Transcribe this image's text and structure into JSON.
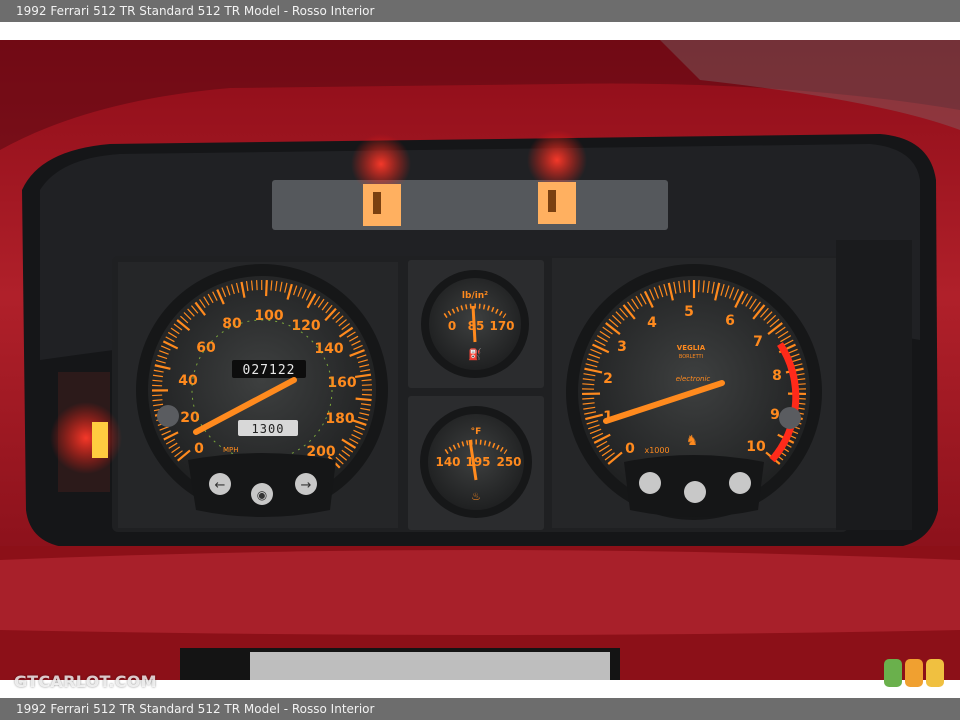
{
  "caption": "1992 Ferrari 512 TR Standard 512 TR Model - Rosso Interior",
  "watermark": "GTCARLOT.COM",
  "odometer": "027122",
  "trip": "1300",
  "speedometer": {
    "labels": [
      "0",
      "20",
      "40",
      "60",
      "80",
      "100",
      "120",
      "140",
      "160",
      "180",
      "200"
    ],
    "units": "MPH"
  },
  "oil_pressure": {
    "unit": "lb/in²",
    "labels": [
      "0",
      "85",
      "170"
    ]
  },
  "water_temp": {
    "unit": "°F",
    "labels": [
      "140",
      "195",
      "250"
    ]
  },
  "tachometer": {
    "labels": [
      "0",
      "1",
      "2",
      "3",
      "4",
      "5",
      "6",
      "7",
      "8",
      "9",
      "10"
    ],
    "scale_note": "x1000",
    "brand": "VEGLIA",
    "brand_sub": "BORLETTI",
    "inner_text": "electronic"
  },
  "colors": {
    "interior_red": "#a4141e",
    "gauge_orange": "#ff8a1e",
    "warning_red": "#ff2a1a",
    "amber": "#ffb02e",
    "bar_grey": "#6d6d6d"
  },
  "rating_lights": [
    "#6ab04c",
    "#f0a030",
    "#f0c040"
  ]
}
